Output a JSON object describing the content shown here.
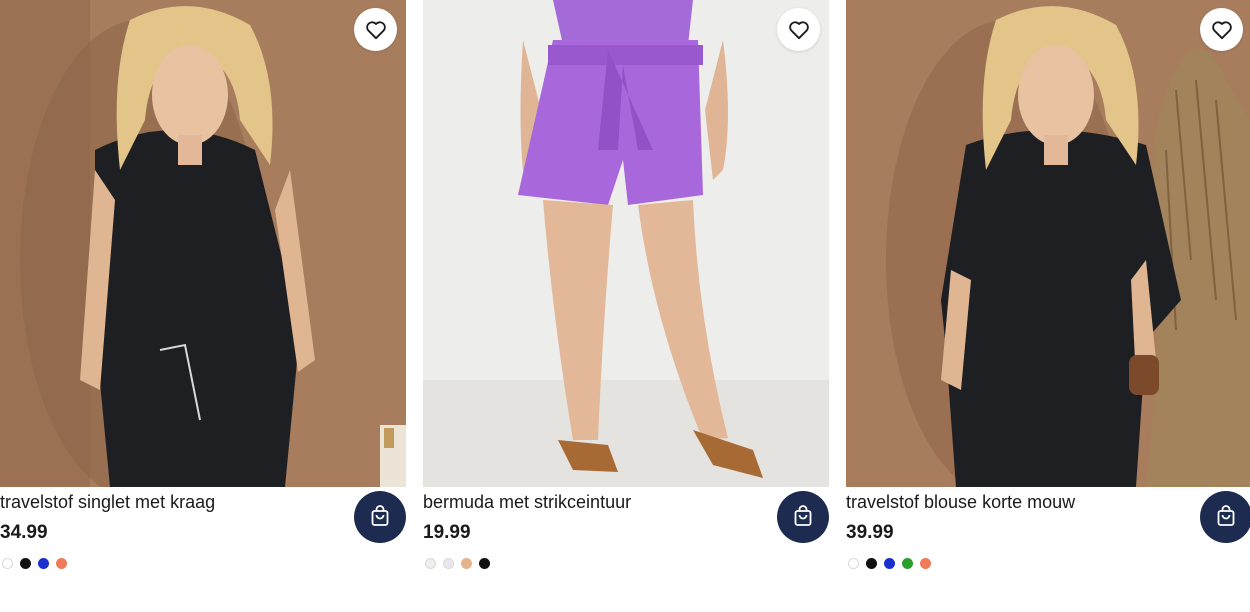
{
  "products": [
    {
      "name": "travelstof singlet met kraag",
      "price": "34.99",
      "favorite_icon": "heart-outline-icon",
      "cart_icon": "shopping-bag-icon",
      "swatches": [
        "#ffffff",
        "#111111",
        "#1a2fd0",
        "#f07a5a"
      ]
    },
    {
      "name": "bermuda met strikceintuur",
      "price": "19.99",
      "favorite_icon": "heart-outline-icon",
      "cart_icon": "shopping-bag-icon",
      "swatches": [
        "#eeeeee",
        "#e6e8ee",
        "#e3b38e",
        "#111111"
      ]
    },
    {
      "name": "travelstof blouse korte mouw",
      "price": "39.99",
      "favorite_icon": "heart-outline-icon",
      "cart_icon": "shopping-bag-icon",
      "swatches": [
        "#ffffff",
        "#111111",
        "#1a2fd0",
        "#2aa02a",
        "#f07a5a"
      ]
    }
  ],
  "colors": {
    "cart_button": "#1c2b4f",
    "favorite_button": "#ffffff",
    "photo_background_warm": "#a87d5e",
    "photo_background_studio": "#ededeb"
  }
}
